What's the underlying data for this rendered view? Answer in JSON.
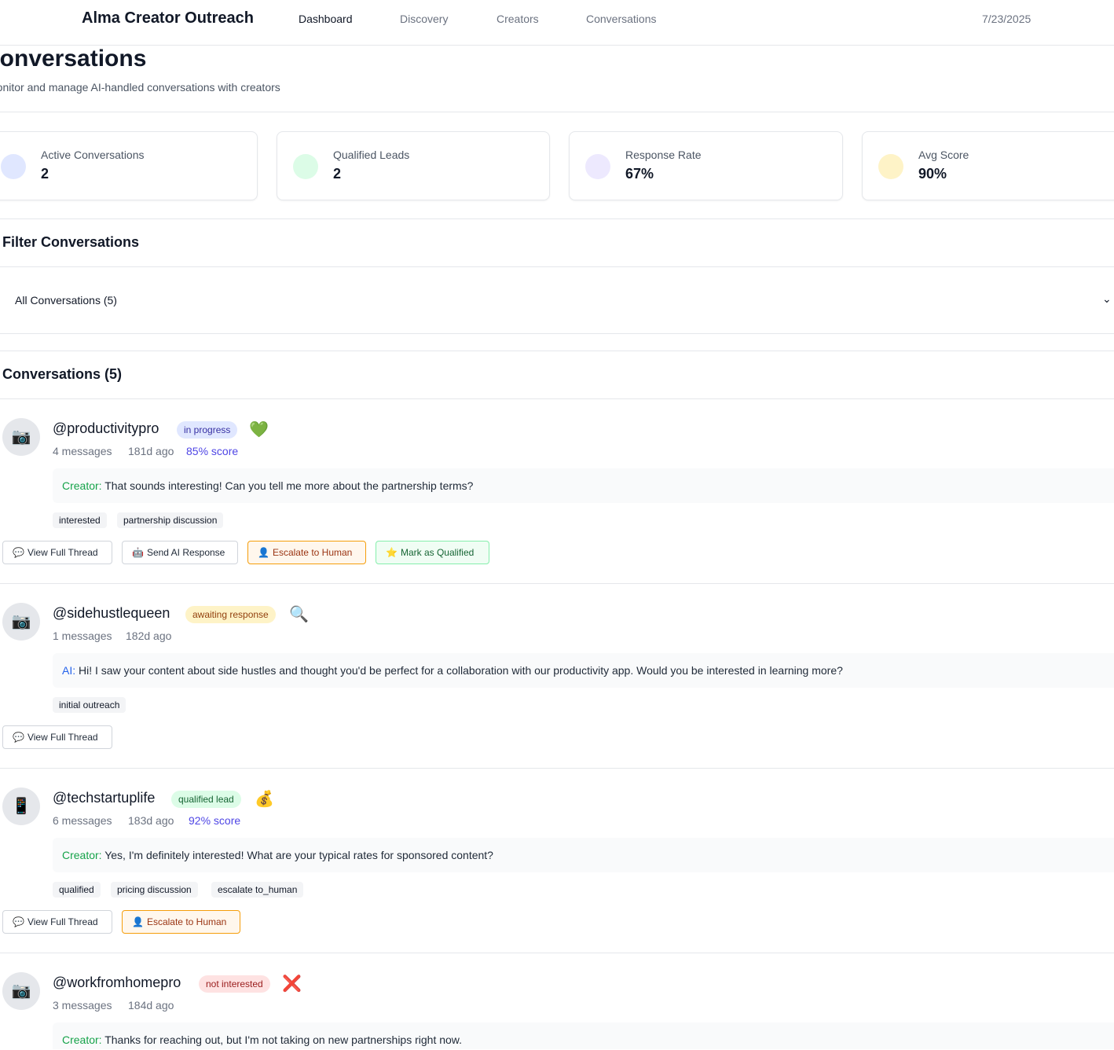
{
  "nav": {
    "brand": "Alma Creator Outreach",
    "links": [
      "Dashboard",
      "Discovery",
      "Creators",
      "Conversations"
    ],
    "date": "7/23/2025"
  },
  "header": {
    "title": "Conversations",
    "subtitle": "Monitor and manage AI-handled conversations with creators"
  },
  "stats": [
    {
      "label": "Active Conversations",
      "value": "2",
      "color": "#e0e7ff"
    },
    {
      "label": "Qualified Leads",
      "value": "2",
      "color": "#dcfce7"
    },
    {
      "label": "Response Rate",
      "value": "67%",
      "color": "#ede9fe"
    },
    {
      "label": "Avg Score",
      "value": "90%",
      "color": "#fef3c7"
    }
  ],
  "filter": {
    "title": "Filter Conversations",
    "selected": "All Conversations (5)"
  },
  "list": {
    "title": "Conversations (5)",
    "items": [
      {
        "avatar": "📷",
        "handle": "@productivitypro",
        "status": "in progress",
        "emoji": "💚",
        "messages": "4 messages",
        "age": "181d ago",
        "score": "85% score",
        "who": "Creator:",
        "text": "That sounds interesting! Can you tell me more about the partnership terms?",
        "tags": [
          "interested",
          "partnership discussion"
        ],
        "buttons": [
          "View Full Thread",
          "Send AI Response",
          "Escalate to Human",
          "Mark as Qualified"
        ]
      },
      {
        "avatar": "📷",
        "handle": "@sidehustlequeen",
        "status": "awaiting response",
        "emoji": "🔍",
        "messages": "1 messages",
        "age": "182d ago",
        "who": "AI:",
        "text": "Hi! I saw your content about side hustles and thought you'd be perfect for a collaboration with our productivity app. Would you be interested in learning more?",
        "tags": [
          "initial outreach"
        ],
        "buttons": [
          "View Full Thread"
        ]
      },
      {
        "avatar": "📱",
        "handle": "@techstartuplife",
        "status": "qualified lead",
        "emoji": "💰",
        "messages": "6 messages",
        "age": "183d ago",
        "score": "92% score",
        "who": "Creator:",
        "text": "Yes, I'm definitely interested! What are your typical rates for sponsored content?",
        "tags": [
          "qualified",
          "pricing discussion",
          "escalate to_human"
        ],
        "buttons": [
          "View Full Thread",
          "Escalate to Human"
        ]
      },
      {
        "avatar": "📷",
        "handle": "@workfromhomepro",
        "status": "not interested",
        "emoji": "❌",
        "messages": "3 messages",
        "age": "184d ago",
        "who": "Creator:",
        "text": "Thanks for reaching out, but I'm not taking on new partnerships right now."
      }
    ]
  },
  "icons": {
    "thread": "💬",
    "robot": "🤖",
    "person": "👤",
    "star": "⭐"
  }
}
